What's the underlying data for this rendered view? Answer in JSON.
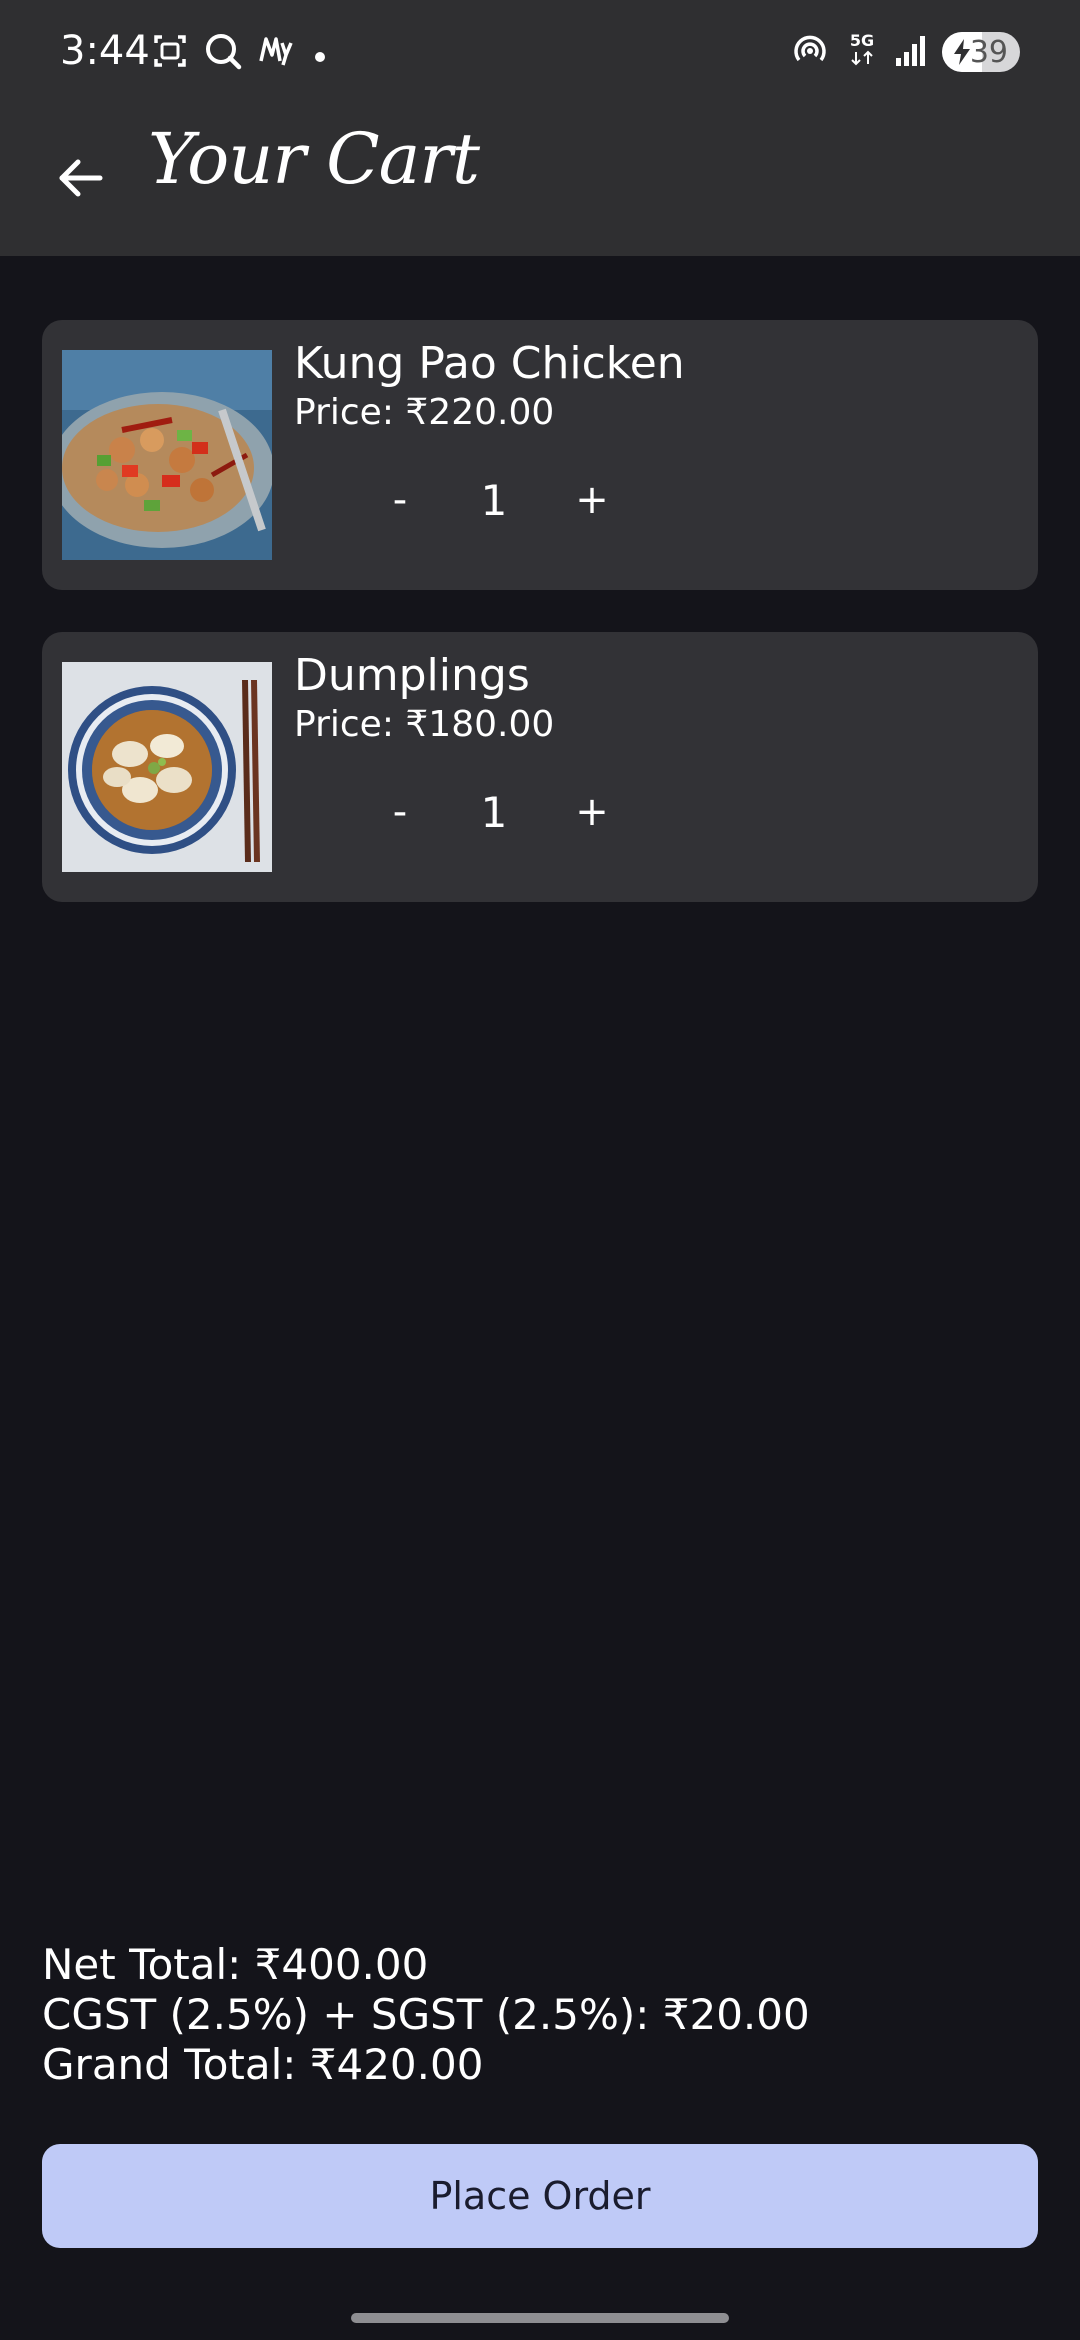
{
  "status_bar": {
    "time": "3:44",
    "battery_level": "39",
    "network": "5G",
    "icons": [
      "screenshot-icon",
      "search-icon",
      "myntra-icon",
      "notification-dot-icon",
      "hotspot-icon",
      "network-5g-icon",
      "signal-icon",
      "battery-charging-icon"
    ]
  },
  "app_bar": {
    "title": "Your Cart",
    "back_icon": "arrow-left-icon"
  },
  "cart": {
    "items": [
      {
        "name": "Kung Pao Chicken",
        "price": "Price: ₹220.00",
        "minus": "-",
        "quantity": "1",
        "plus": "+",
        "image": "kung-pao-chicken-photo"
      },
      {
        "name": "Dumplings",
        "price": "Price: ₹180.00",
        "minus": "-",
        "quantity": "1",
        "plus": "+",
        "image": "dumplings-soup-photo"
      }
    ]
  },
  "summary": {
    "net_total": "Net Total: ₹400.00",
    "tax": "CGST (2.5%) + SGST (2.5%): ₹20.00",
    "grand_total": "Grand Total: ₹420.00"
  },
  "actions": {
    "place_order_label": "Place Order"
  },
  "colors": {
    "background": "#14141a",
    "bar": "#2f2f31",
    "card": "#323236",
    "button": "#bfcaf7",
    "button_text": "#1a1c2e"
  }
}
